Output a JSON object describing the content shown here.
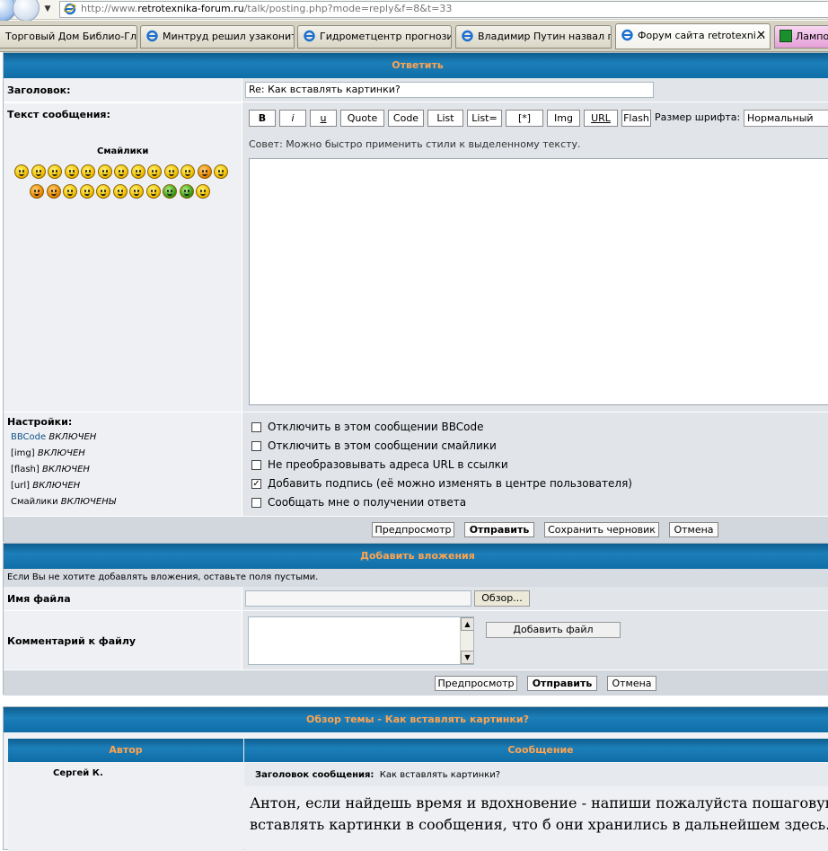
{
  "browser": {
    "url_prefix": "http://www.",
    "url_host": "retrotexnika-forum.ru",
    "url_path": "/talk/posting.php?mode=reply&f=8&t=33",
    "tabs": [
      {
        "label": "Торговый Дом Библио-Гл..."
      },
      {
        "label": "Минтруд решил узаконит..."
      },
      {
        "label": "Гидрометцентр прогнози..."
      },
      {
        "label": "Владимир Путин назвал п..."
      },
      {
        "label": "Форум сайта retrotexni..."
      },
      {
        "label": "Лампое"
      }
    ],
    "close_glyph": "✕"
  },
  "reply": {
    "header": "Ответить",
    "subject_label": "Заголовок:",
    "subject_value": "Re: Как вставлять картинки?",
    "body_label": "Текст сообщения:",
    "smilies_title": "Смайлики",
    "toolbar": {
      "bold": "B",
      "italic": "i",
      "underline": "u",
      "quote": "Quote",
      "code": "Code",
      "list": "List",
      "list_eq": "List=",
      "star": "[*]",
      "img": "Img",
      "url": "URL",
      "flash": "Flash",
      "font_size_label": "Размер шрифта:",
      "font_size_value": "Нормальный"
    },
    "hint": "Совет: Можно быстро применить стили к выделенному тексту.",
    "settings_label": "Настройки:",
    "settings_status": [
      {
        "name": "BBCode",
        "state": "ВКЛЮЧЕН"
      },
      {
        "name": "[img]",
        "state": "ВКЛЮЧЕН"
      },
      {
        "name": "[flash]",
        "state": "ВКЛЮЧЕН"
      },
      {
        "name": "[url]",
        "state": "ВКЛЮЧЕН"
      },
      {
        "name": "Смайлики",
        "state": "ВКЛЮЧЕНЫ"
      }
    ],
    "options": [
      {
        "label": "Отключить в этом сообщении BBCode",
        "checked": ""
      },
      {
        "label": "Отключить в этом сообщении смайлики",
        "checked": ""
      },
      {
        "label": "Не преобразовывать адреса URL в ссылки",
        "checked": ""
      },
      {
        "label": "Добавить подпись (её можно изменять в центре пользователя)",
        "checked": "✓"
      },
      {
        "label": "Сообщать мне о получении ответа",
        "checked": ""
      }
    ],
    "buttons": {
      "preview": "Предпросмотр",
      "submit": "Отправить",
      "save_draft": "Сохранить черновик",
      "cancel": "Отмена"
    }
  },
  "attach": {
    "header": "Добавить вложения",
    "note": "Если Вы не хотите добавлять вложения, оставьте поля пустыми.",
    "filename_label": "Имя файла",
    "browse": "Обзор...",
    "comment_label": "Комментарий к файлу",
    "add_file": "Добавить файл",
    "buttons": {
      "preview": "Предпросмотр",
      "submit": "Отправить",
      "cancel": "Отмена"
    }
  },
  "review": {
    "header": "Обзор темы - Как вставлять картинки?",
    "col_author": "Автор",
    "col_message": "Сообщение",
    "author": "Сергей К.",
    "subject_label": "Заголовок сообщения:",
    "subject_value": "Как вставлять картинки?",
    "body_line1": "Антон, если найдешь время и вдохновение - напиши пожалуйста пошаговую",
    "body_line2": "вставлять картинки в сообщения, что б они хранились в дальнейшем здесь."
  }
}
